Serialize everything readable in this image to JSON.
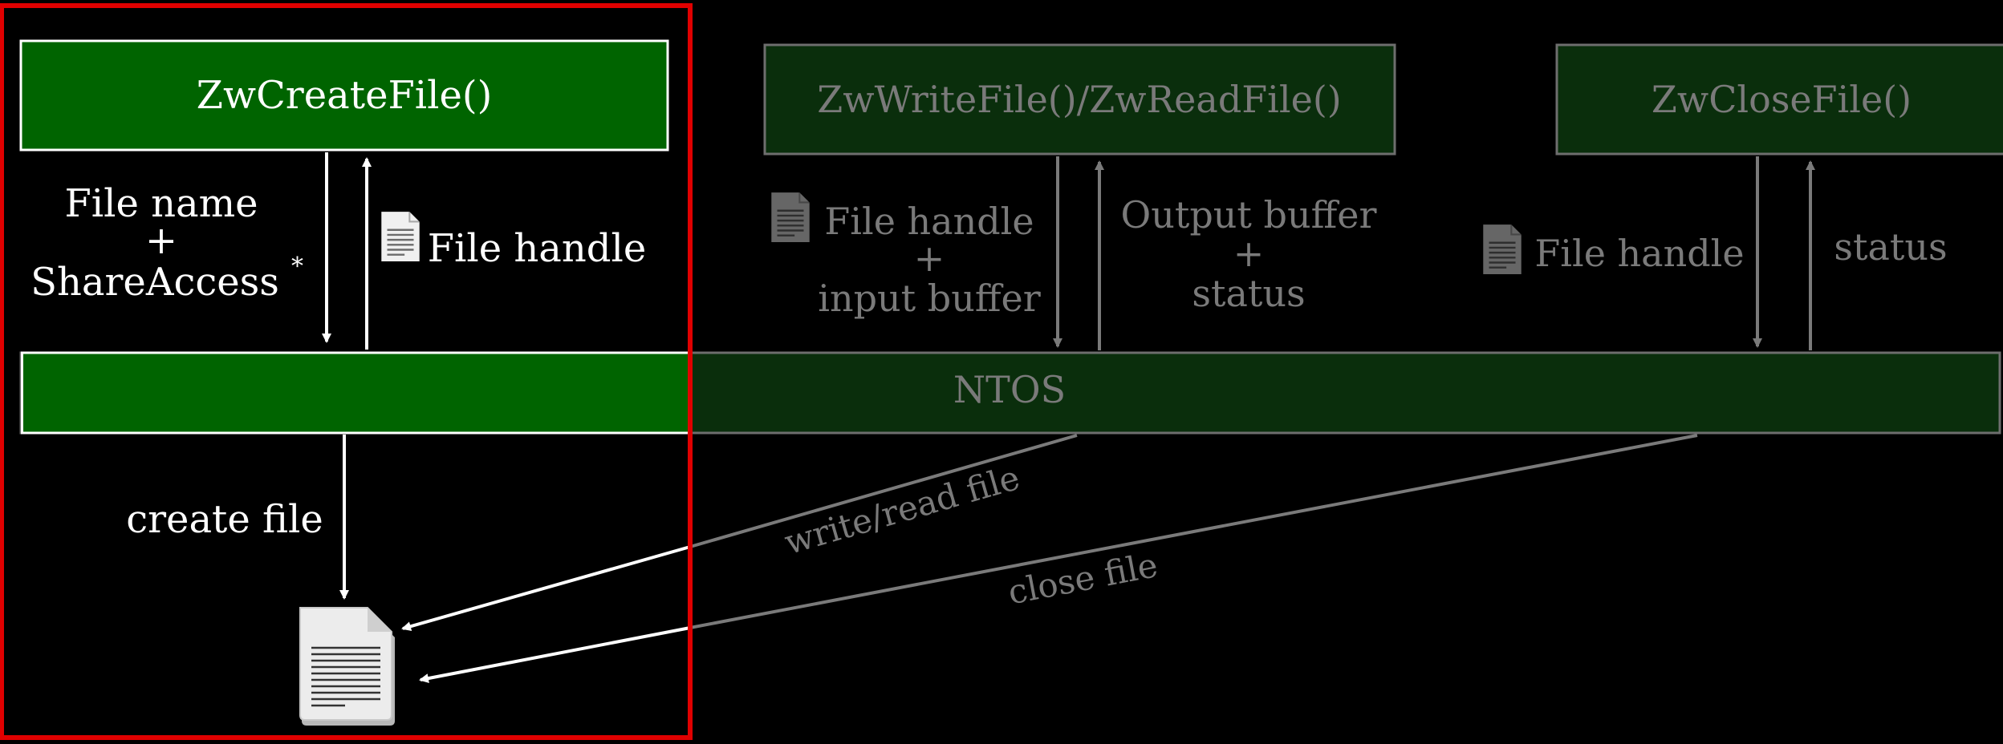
{
  "boxes": {
    "create": "ZwCreateFile()",
    "write_read": "ZwWriteFile()/ZwReadFile()",
    "close": "ZwCloseFile()",
    "ntos": "NTOS"
  },
  "create_call": {
    "in_line1": "File name",
    "in_line2": "+",
    "in_line3": "ShareAccess",
    "in_footnote": "*",
    "out": "File handle",
    "down": "create file"
  },
  "write_call": {
    "in_line1": "File handle",
    "in_line2": "+",
    "in_line3": "input buffer",
    "out_line1": "Output buffer",
    "out_line2": "+",
    "out_line3": "status",
    "diag": "write/read file"
  },
  "close_call": {
    "in": "File handle",
    "out": "status",
    "diag": "close file"
  },
  "icons": [
    "document-icon",
    "small-document-icon"
  ],
  "colors": {
    "background": "#000000",
    "green_bright": "#006400",
    "green_dim": "#0a2e0c",
    "highlight_border": "#e00000",
    "text_bright": "#ffffff",
    "text_dim": "#7a7a7a"
  }
}
